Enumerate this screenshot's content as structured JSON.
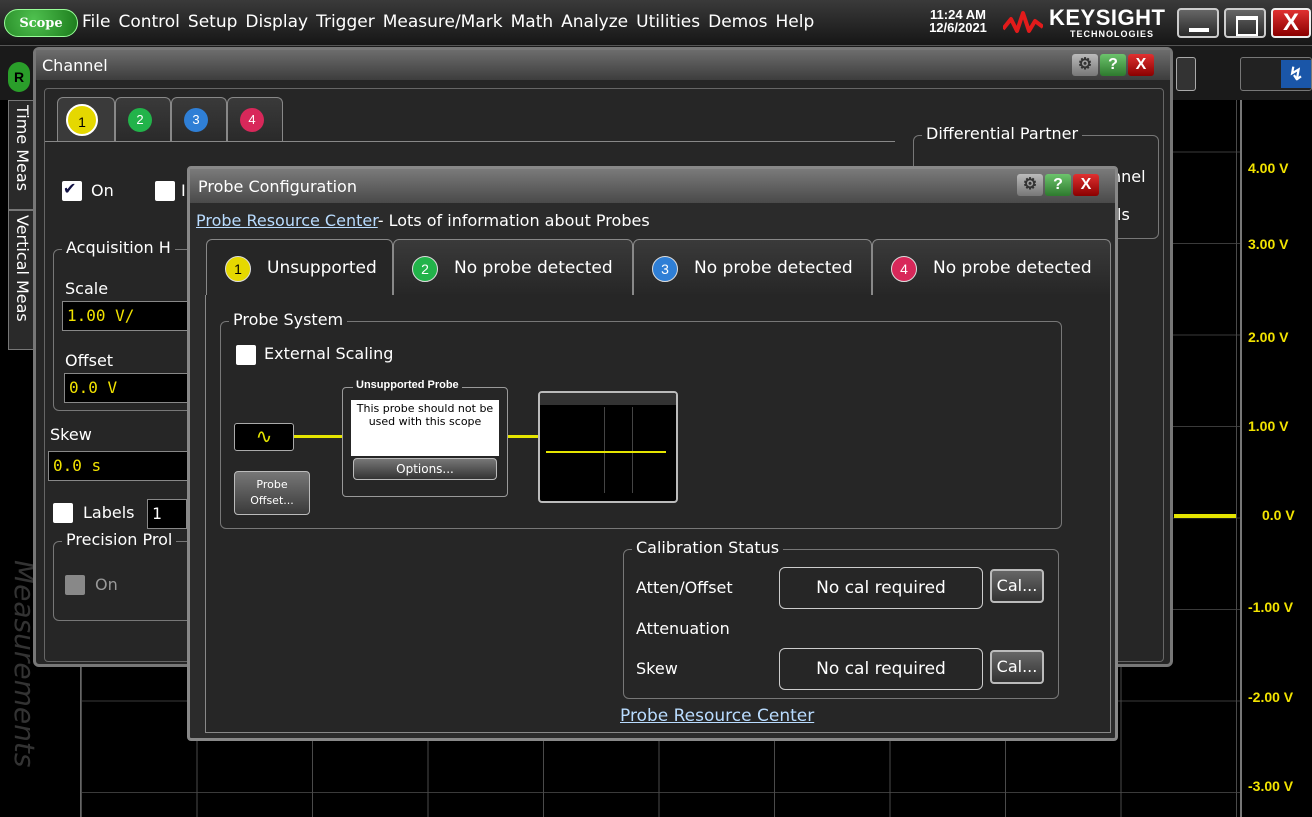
{
  "menubar": {
    "logo": "Scope",
    "items": [
      "File",
      "Control",
      "Setup",
      "Display",
      "Trigger",
      "Measure/Mark",
      "Math",
      "Analyze",
      "Utilities",
      "Demos",
      "Help"
    ],
    "time": "11:24 AM",
    "date": "12/6/2021",
    "brand": "KEYSIGHT",
    "brand_sub": "TECHNOLOGIES",
    "close_label": "X"
  },
  "toolbar2": {
    "run_label": "R"
  },
  "side_tabs": {
    "time_meas": "Time Meas",
    "vertical_meas": "Vertical Meas",
    "measurements": "Measurements"
  },
  "volt_labels": [
    "4.00 V",
    "3.00 V",
    "2.00 V",
    "1.00 V",
    "0.0 V",
    "-1.00 V",
    "-2.00 V",
    "-3.00 V"
  ],
  "channel_dialog": {
    "title": "Channel",
    "tabs": [
      "1",
      "2",
      "3",
      "4"
    ],
    "on_label": "On",
    "on_checked": true,
    "second_check_label": "I",
    "acquisition_title": "Acquisition H",
    "scale_label": "Scale",
    "scale_value": "1.00 V/",
    "offset_label": "Offset",
    "offset_value": "0.0 V",
    "skew_label": "Skew",
    "skew_value": "0.0 s",
    "labels_label": "Labels",
    "labels_value": "1",
    "precision_title": "Precision Prol",
    "precision_on_label": "On",
    "diff_partner_title": "Differential Partner",
    "diff_partner_line1": "nnel",
    "diff_partner_line2": "ls"
  },
  "probe_dialog": {
    "title": "Probe Configuration",
    "link_top": "Probe Resource Center",
    "link_top_suffix": "- Lots of information about Probes",
    "tabs": [
      {
        "num": "1",
        "label": "Unsupported",
        "color": "#e5d800"
      },
      {
        "num": "2",
        "label": "No probe detected",
        "color": "#22b34a"
      },
      {
        "num": "3",
        "label": "No probe detected",
        "color": "#2f7fd6"
      },
      {
        "num": "4",
        "label": "No probe detected",
        "color": "#d8285a"
      }
    ],
    "probe_system_title": "Probe System",
    "external_scaling_label": "External Scaling",
    "external_scaling_checked": false,
    "signal_symbol": "∿",
    "unsupported_title": "Unsupported  Probe",
    "unsupported_message": "This probe should not be used with this scope",
    "options_button": "Options...",
    "probe_offset_button_line1": "Probe",
    "probe_offset_button_line2": "Offset...",
    "calibration_title": "Calibration Status",
    "atten_offset_label": "Atten/Offset",
    "atten_offset_value": "No cal required",
    "attenuation_label": "Attenuation",
    "skew_label": "Skew",
    "skew_value": "No cal required",
    "cal_button": "Cal...",
    "link_bottom": "Probe Resource Center"
  },
  "colors": {
    "ch1": "#e5d800",
    "ch2": "#22b34a",
    "ch3": "#2f7fd6",
    "ch4": "#d8285a",
    "trace": "#e5e500",
    "link": "#b9dcff"
  }
}
